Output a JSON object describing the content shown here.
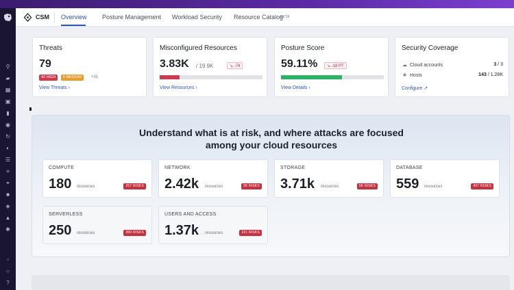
{
  "app": {
    "name": "CSM"
  },
  "tabs": [
    {
      "label": "Overview",
      "active": true
    },
    {
      "label": "Posture Management",
      "active": false
    },
    {
      "label": "Workload Security",
      "active": false
    },
    {
      "label": "Resource Catalog",
      "active": false,
      "badge": "BETA"
    }
  ],
  "colors": {
    "accent": "#2553c9",
    "danger": "#d23a4b",
    "warning": "#e89c2b",
    "success": "#28b463",
    "sidebar": "#1a1530"
  },
  "cards": {
    "threats": {
      "title": "Threats",
      "value": "79",
      "high": "42 HIGH",
      "medium": "6 MEDIUM",
      "more": "+31",
      "link": "View Threats"
    },
    "misconfig": {
      "title": "Misconfigured Resources",
      "value": "3.83K",
      "total": "/ 19.9K",
      "delta": "-74",
      "fill_fraction": 0.19,
      "link": "View Resources"
    },
    "posture": {
      "title": "Posture Score",
      "value": "59.11%",
      "delta": "-18 PT",
      "fill_fraction": 0.5911,
      "link": "View Details"
    },
    "coverage": {
      "title": "Security Coverage",
      "rows": [
        {
          "icon": "cloud-icon",
          "label": "Cloud accounts",
          "value": "3",
          "total": "/ 3"
        },
        {
          "icon": "hosts-icon",
          "label": "Hosts",
          "value": "143",
          "total": "/ 1.28K"
        }
      ],
      "link": "Configure"
    }
  },
  "risk_panel": {
    "headline_line1": "Understand what is at risk, and where attacks are focused",
    "headline_line2": "among your cloud resources",
    "resources_label": "resources",
    "items": [
      {
        "label": "COMPUTE",
        "value": "180",
        "risks": "257 RISKS"
      },
      {
        "label": "NETWORK",
        "value": "2.42k",
        "risks": "2K RISKS"
      },
      {
        "label": "STORAGE",
        "value": "3.71k",
        "risks": "5K RISKS"
      },
      {
        "label": "DATABASE",
        "value": "559",
        "risks": "407 RISKS"
      },
      {
        "label": "SERVERLESS",
        "value": "250",
        "risks": "360 RISKS"
      },
      {
        "label": "USERS AND ACCESS",
        "value": "1.37k",
        "risks": "321 RISKS"
      }
    ]
  }
}
